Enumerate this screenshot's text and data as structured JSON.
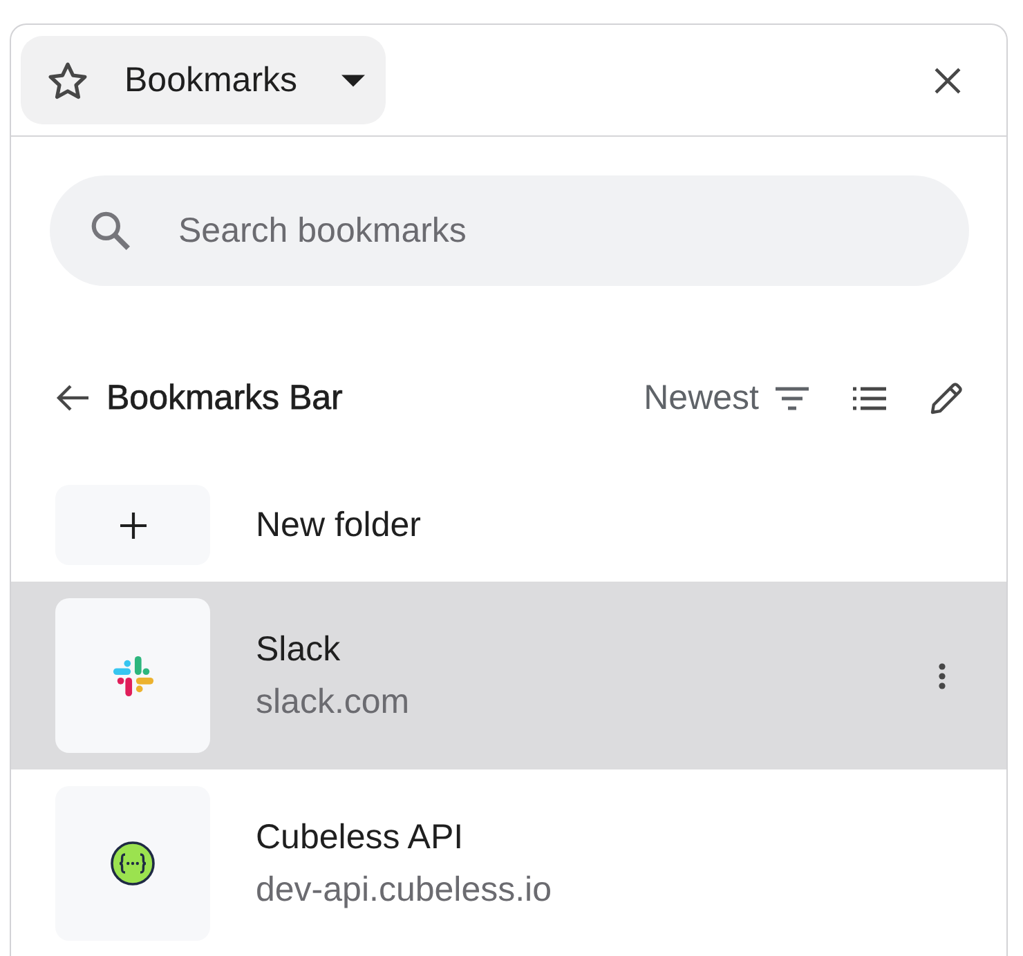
{
  "header": {
    "title": "Bookmarks"
  },
  "search": {
    "placeholder": "Search bookmarks"
  },
  "folder_bar": {
    "title": "Bookmarks Bar",
    "sort": "Newest"
  },
  "items": [
    {
      "kind": "new_folder",
      "title": "New folder",
      "selected": false
    },
    {
      "kind": "bookmark",
      "title": "Slack",
      "url": "slack.com",
      "selected": true
    },
    {
      "kind": "bookmark",
      "title": "Cubeless API",
      "url": "dev-api.cubeless.io",
      "selected": false
    }
  ]
}
